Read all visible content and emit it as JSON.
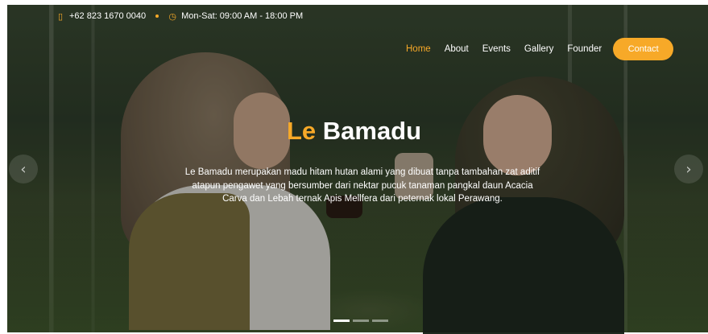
{
  "colors": {
    "accent": "#f7a928",
    "text": "#ffffff"
  },
  "topbar": {
    "phone_icon": "phone-icon",
    "phone": "+62 823 1670 0040",
    "clock_icon": "clock-icon",
    "hours": "Mon-Sat: 09:00 AM - 18:00 PM"
  },
  "nav": {
    "items": [
      {
        "label": "Home",
        "active": true
      },
      {
        "label": "About"
      },
      {
        "label": "Events"
      },
      {
        "label": "Gallery"
      },
      {
        "label": "Founder"
      }
    ],
    "contact_label": "Contact"
  },
  "hero": {
    "title_accent": "Le",
    "title_rest": "Bamadu",
    "description": "Le Bamadu merupakan madu hitam hutan alami yang dibuat tanpa tambahan zat aditif atapun pengawet yang bersumber dari nektar pucuk tanaman pangkal daun Acacia Carva dan Lebah ternak Apis Mellfera dari peternak lokal Perawang.",
    "prev_icon": "chevron-left-icon",
    "next_icon": "chevron-right-icon",
    "slides": 3,
    "active_slide": 1
  }
}
